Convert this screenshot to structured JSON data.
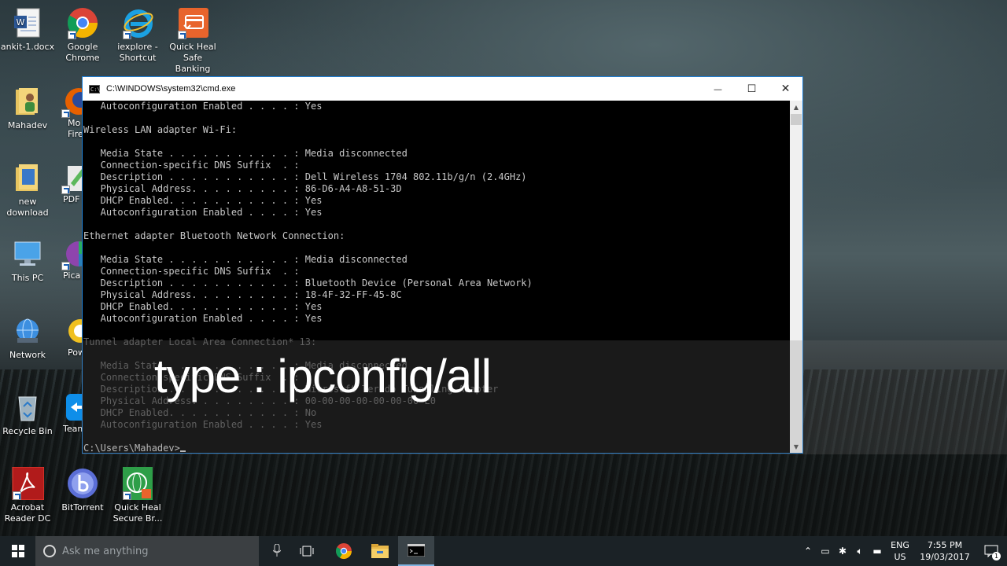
{
  "desktop": {
    "icons": [
      {
        "label": "ankit-1.docx"
      },
      {
        "label": "Google\nChrome"
      },
      {
        "label": "iexplore -\nShortcut"
      },
      {
        "label": "Quick Heal\nSafe Banking"
      },
      {
        "label": "Mahadev"
      },
      {
        "label": "Mo\nFire"
      },
      {
        "label": "new\ndownload"
      },
      {
        "label": "PDF I"
      },
      {
        "label": "This PC"
      },
      {
        "label": "Pica"
      },
      {
        "label": "Network"
      },
      {
        "label": "Pow"
      },
      {
        "label": "Recycle Bin"
      },
      {
        "label": "Team"
      },
      {
        "label": "Acrobat\nReader DC"
      },
      {
        "label": "BitTorrent"
      },
      {
        "label": "Quick Heal\nSecure Br..."
      }
    ]
  },
  "cmd": {
    "title": "C:\\WINDOWS\\system32\\cmd.exe",
    "icon_text": "C:\\",
    "minimize": "—",
    "maximize": "☐",
    "close": "✕",
    "lines": [
      "   Autoconfiguration Enabled . . . . : Yes",
      "",
      "Wireless LAN adapter Wi-Fi:",
      "",
      "   Media State . . . . . . . . . . . : Media disconnected",
      "   Connection-specific DNS Suffix  . :",
      "   Description . . . . . . . . . . . : Dell Wireless 1704 802.11b/g/n (2.4GHz)",
      "   Physical Address. . . . . . . . . : 86-D6-A4-A8-51-3D",
      "   DHCP Enabled. . . . . . . . . . . : Yes",
      "   Autoconfiguration Enabled . . . . : Yes",
      "",
      "Ethernet adapter Bluetooth Network Connection:",
      "",
      "   Media State . . . . . . . . . . . : Media disconnected",
      "   Connection-specific DNS Suffix  . :",
      "   Description . . . . . . . . . . . : Bluetooth Device (Personal Area Network)",
      "   Physical Address. . . . . . . . . : 18-4F-32-FF-45-8C",
      "   DHCP Enabled. . . . . . . . . . . : Yes",
      "   Autoconfiguration Enabled . . . . : Yes",
      "",
      "Tunnel adapter Local Area Connection* 13:",
      "",
      "   Media State . . . . . . . . . . . : Media disconnected",
      "   Connection-specific DNS Suffix  . :",
      "   Description . . . . . . . . . . . : Microsoft Teredo Tunneling Adapter",
      "   Physical Address. . . . . . . . . : 00-00-00-00-00-00-00-E0",
      "   DHCP Enabled. . . . . . . . . . . : No",
      "   Autoconfiguration Enabled . . . . : Yes",
      "",
      "C:\\Users\\Mahadev>"
    ],
    "dim_from_line": 20
  },
  "overlay": {
    "caption": "type : ipconfig/all"
  },
  "taskbar": {
    "search_placeholder": "Ask me anything",
    "tray": {
      "language": "ENG",
      "region": "US",
      "time": "7:55 PM",
      "date": "19/03/2017",
      "notification_count": "1"
    }
  },
  "colors": {
    "accent": "#1e7fd6",
    "console_text": "#c8c8c8",
    "console_bg": "#000000",
    "taskbar": "#1b2226"
  }
}
